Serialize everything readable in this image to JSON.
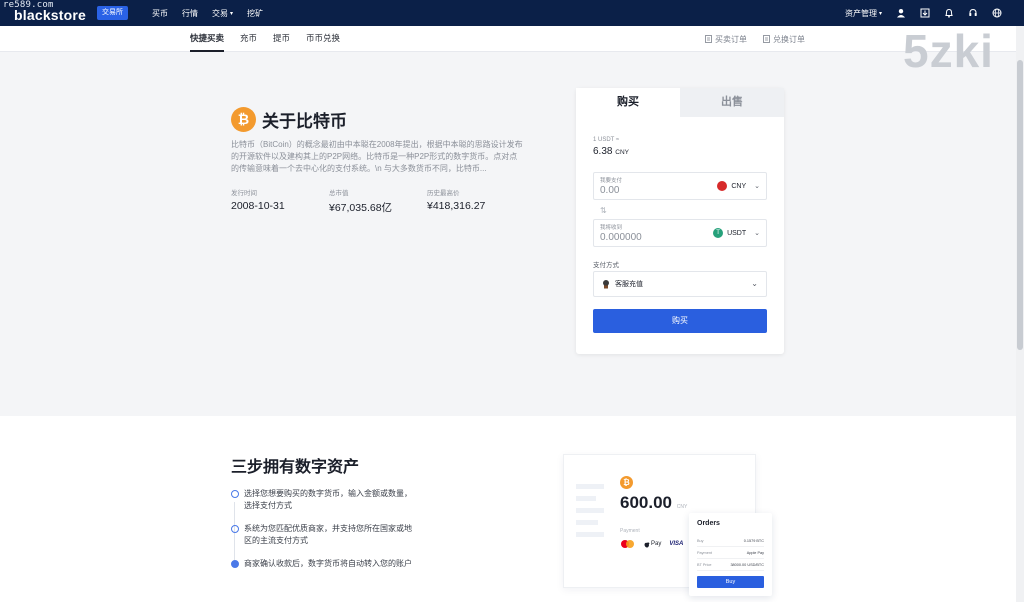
{
  "watermarks": {
    "url": "re589.com",
    "big": "5zki"
  },
  "topbar": {
    "logo": "blackstore",
    "exchange_button": "交易所",
    "nav": [
      {
        "label": "买币",
        "caret": false
      },
      {
        "label": "行情",
        "caret": false
      },
      {
        "label": "交易",
        "caret": true
      },
      {
        "label": "挖矿",
        "caret": false
      }
    ],
    "assets": "资产管理",
    "icons": [
      "user-icon",
      "download-icon",
      "bell-icon",
      "headset-icon",
      "globe-icon"
    ]
  },
  "subnav": {
    "tabs": [
      "快捷买卖",
      "充币",
      "提币",
      "币币兑换"
    ],
    "active_tab": 0,
    "orders": [
      "买卖订单",
      "兑换订单"
    ]
  },
  "coin": {
    "symbol": "₿",
    "title": "关于比特币",
    "description": "比特币（BitCoin）的概念最初由中本聪在2008年提出，根据中本聪的思路设计发布的开源软件以及建构其上的P2P网络。比特币是一种P2P形式的数字货币。点对点的传输意味着一个去中心化的支付系统。\\n 与大多数货币不同，比特币...",
    "stats": [
      {
        "label": "发行时间",
        "value": "2008-10-31"
      },
      {
        "label": "总市值",
        "value": "¥67,035.68亿"
      },
      {
        "label": "历史最高价",
        "value": "¥418,316.27"
      }
    ]
  },
  "trade": {
    "tab_buy": "购买",
    "tab_sell": "出售",
    "rate_label": "1 USDT ≈",
    "rate_value": "6.38",
    "rate_unit": "CNY",
    "pay_field": {
      "label": "我要支付",
      "value": "0.00",
      "currency": "CNY"
    },
    "receive_field": {
      "label": "我将收到",
      "value": "0.000000",
      "currency": "USDT"
    },
    "method_label": "支付方式",
    "method_value": "客服充值",
    "submit": "购买"
  },
  "steps": {
    "title": "三步拥有数字资产",
    "items": [
      "选择您想要购买的数字货币，输入金额或数量，选择支付方式",
      "系统为您匹配优质商家，并支持您所在国家或地区的主流支付方式",
      "商家确认收款后，数字货币将自动转入您的账户"
    ]
  },
  "mock": {
    "amount": "600.00",
    "amount_unit": "CNY",
    "payment_label": "Payment",
    "apple_pay": "Pay",
    "visa": "VISA",
    "orders_title": "Orders",
    "rows": [
      {
        "k": "Buy",
        "v": "0.1579 BTC"
      },
      {
        "k": "Payment",
        "v": "Apple Pay"
      },
      {
        "k": "BT Price",
        "v": "38000.00 USD/BTC"
      }
    ],
    "orders_button": "Buy"
  },
  "colors": {
    "topbar": "#0b2048",
    "primary": "#2a5fdf",
    "bitcoin": "#f39a2e"
  }
}
